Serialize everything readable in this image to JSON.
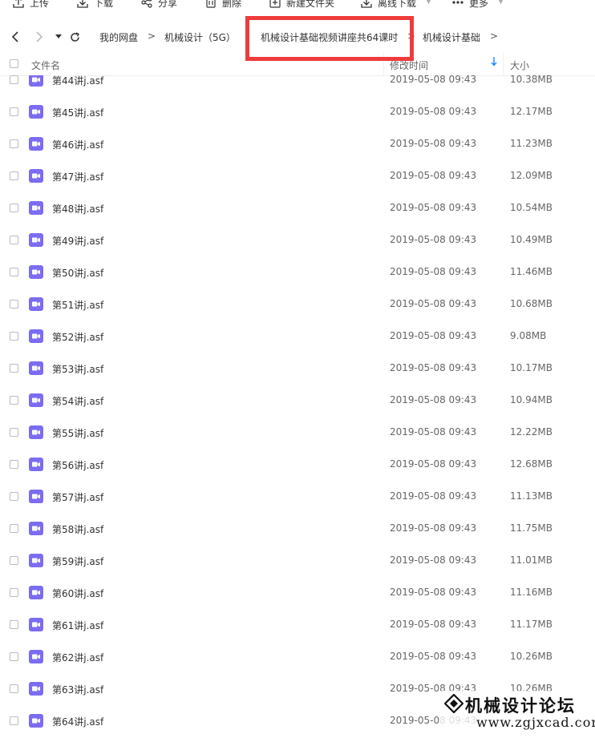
{
  "toolbar": {
    "upload_label": "上传",
    "download_label": "下载",
    "share_label": "分享",
    "delete_label": "删除",
    "new_folder_label": "新建文件夹",
    "offline_download_label": "离线下载",
    "more_label": "更多"
  },
  "breadcrumb": {
    "items": [
      "我的网盘",
      "机械设计（5G）",
      "机械设计基础视频讲座共64课时",
      "机械设计基础"
    ],
    "separator": ">"
  },
  "table": {
    "headers": {
      "name": "文件名",
      "modified": "修改时间",
      "size": "大小"
    },
    "rows": [
      {
        "name": "第44讲j.asf",
        "modified": "2019-05-08 09:43",
        "size": "10.38MB"
      },
      {
        "name": "第45讲j.asf",
        "modified": "2019-05-08 09:43",
        "size": "12.17MB"
      },
      {
        "name": "第46讲j.asf",
        "modified": "2019-05-08 09:43",
        "size": "11.23MB"
      },
      {
        "name": "第47讲j.asf",
        "modified": "2019-05-08 09:43",
        "size": "12.09MB"
      },
      {
        "name": "第48讲j.asf",
        "modified": "2019-05-08 09:43",
        "size": "10.54MB"
      },
      {
        "name": "第49讲j.asf",
        "modified": "2019-05-08 09:43",
        "size": "10.49MB"
      },
      {
        "name": "第50讲j.asf",
        "modified": "2019-05-08 09:43",
        "size": "11.46MB"
      },
      {
        "name": "第51讲j.asf",
        "modified": "2019-05-08 09:43",
        "size": "10.68MB"
      },
      {
        "name": "第52讲j.asf",
        "modified": "2019-05-08 09:43",
        "size": "9.08MB"
      },
      {
        "name": "第53讲j.asf",
        "modified": "2019-05-08 09:43",
        "size": "10.17MB"
      },
      {
        "name": "第54讲j.asf",
        "modified": "2019-05-08 09:43",
        "size": "10.94MB"
      },
      {
        "name": "第55讲j.asf",
        "modified": "2019-05-08 09:43",
        "size": "12.22MB"
      },
      {
        "name": "第56讲j.asf",
        "modified": "2019-05-08 09:43",
        "size": "12.68MB"
      },
      {
        "name": "第57讲j.asf",
        "modified": "2019-05-08 09:43",
        "size": "11.13MB"
      },
      {
        "name": "第58讲j.asf",
        "modified": "2019-05-08 09:43",
        "size": "11.75MB"
      },
      {
        "name": "第59讲j.asf",
        "modified": "2019-05-08 09:43",
        "size": "11.01MB"
      },
      {
        "name": "第60讲j.asf",
        "modified": "2019-05-08 09:43",
        "size": "11.16MB"
      },
      {
        "name": "第61讲j.asf",
        "modified": "2019-05-08 09:43",
        "size": "11.17MB"
      },
      {
        "name": "第62讲j.asf",
        "modified": "2019-05-08 09:43",
        "size": "10.26MB"
      },
      {
        "name": "第63讲j.asf",
        "modified": "2019-05-08 09:43",
        "size": "10.26MB"
      },
      {
        "name": "第64讲j.asf",
        "modified": "2019-05-08 09:43",
        "size": ""
      }
    ]
  },
  "watermark": {
    "title": "机械设计论坛",
    "url": "www.zgjxcad.com"
  },
  "colors": {
    "file_icon": "#7b6cf0",
    "highlight_box": "#ef3b3b",
    "sort_arrow": "#2b8cff"
  },
  "icons": {
    "upload": "upload-icon",
    "download": "download-icon",
    "share": "share-icon",
    "delete": "trash-icon",
    "new_folder": "folder-plus-icon",
    "offline_download": "offline-download-icon",
    "more": "more-dots-icon",
    "back": "chevron-left-icon",
    "forward": "chevron-right-icon",
    "history": "caret-down-icon",
    "refresh": "refresh-icon",
    "sort": "sort-desc-icon",
    "file": "video-file-icon"
  }
}
